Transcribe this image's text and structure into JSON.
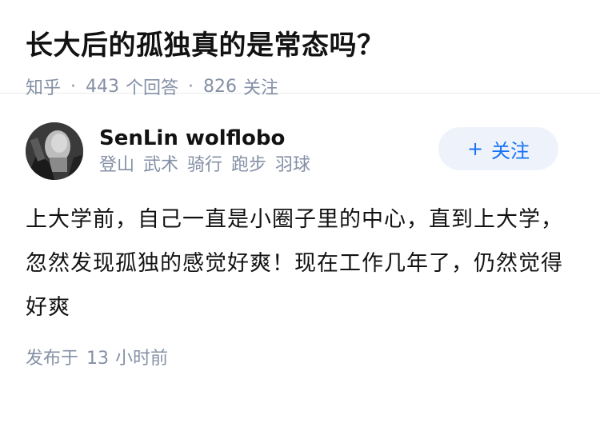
{
  "question": {
    "title": "长大后的孤独真的是常态吗？",
    "source": "知乎",
    "answer_count": "443",
    "answer_label": "个回答",
    "follower_count": "826",
    "follower_label": "关注"
  },
  "answer": {
    "author_name": "SenLin wolflobo",
    "author_bio": "登山 武术 骑行 跑步 羽球",
    "follow_button": {
      "icon": "+",
      "label": "关注"
    },
    "content": "上大学前，自己一直是小圈子里的中心，直到上大学，忽然发现孤独的感觉好爽！现在工作几年了，仍然觉得好爽",
    "published_prefix": "发布于",
    "published_value": "13",
    "published_suffix": "小时前"
  },
  "colors": {
    "accent": "#1772f6",
    "meta": "#8590a6",
    "button_bg": "#eef3fb"
  }
}
